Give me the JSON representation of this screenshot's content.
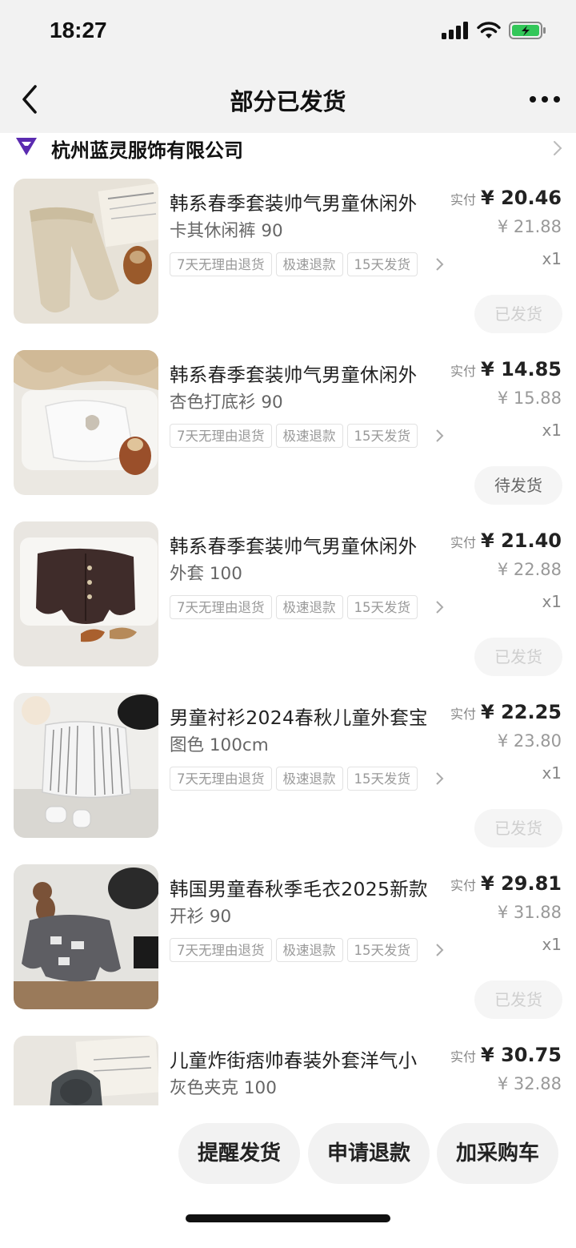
{
  "status": {
    "time": "18:27"
  },
  "nav": {
    "title": "部分已发货"
  },
  "shop": {
    "name": "杭州蓝灵服饰有限公司"
  },
  "paid_label": "实付",
  "items": [
    {
      "title": "韩系春季套装帅气男童休闲外",
      "variant": "卡其休闲裤 90",
      "tags": [
        "7天无理由退货",
        "极速退款",
        "15天发货"
      ],
      "paid": "¥ 20.46",
      "orig": "¥ 21.88",
      "qty": "x1",
      "status": "已发货"
    },
    {
      "title": "韩系春季套装帅气男童休闲外",
      "variant": "杏色打底衫 90",
      "tags": [
        "7天无理由退货",
        "极速退款",
        "15天发货"
      ],
      "paid": "¥ 14.85",
      "orig": "¥ 15.88",
      "qty": "x1",
      "status": "待发货"
    },
    {
      "title": "韩系春季套装帅气男童休闲外",
      "variant": "外套 100",
      "tags": [
        "7天无理由退货",
        "极速退款",
        "15天发货"
      ],
      "paid": "¥ 21.40",
      "orig": "¥ 22.88",
      "qty": "x1",
      "status": "已发货"
    },
    {
      "title": "男童衬衫2024春秋儿童外套宝",
      "variant": "图色 100cm",
      "tags": [
        "7天无理由退货",
        "极速退款",
        "15天发货"
      ],
      "paid": "¥ 22.25",
      "orig": "¥ 23.80",
      "qty": "x1",
      "status": "已发货"
    },
    {
      "title": "韩国男童春秋季毛衣2025新款",
      "variant": "开衫 90",
      "tags": [
        "7天无理由退货",
        "极速退款",
        "15天发货"
      ],
      "paid": "¥ 29.81",
      "orig": "¥ 31.88",
      "qty": "x1",
      "status": "已发货"
    },
    {
      "title": "儿童炸街痞帅春装外套洋气小",
      "variant": "灰色夹克 100",
      "paid": "¥ 30.75",
      "orig": "¥ 32.88"
    }
  ],
  "actions": {
    "remind": "提醒发货",
    "refund": "申请退款",
    "cart": "加采购车"
  },
  "colors": {
    "shop_logo": "#5b2bb0",
    "shipped_btn_text": "#cfcfcf",
    "pending_btn_text": "#666666",
    "battery": "#33c759"
  }
}
